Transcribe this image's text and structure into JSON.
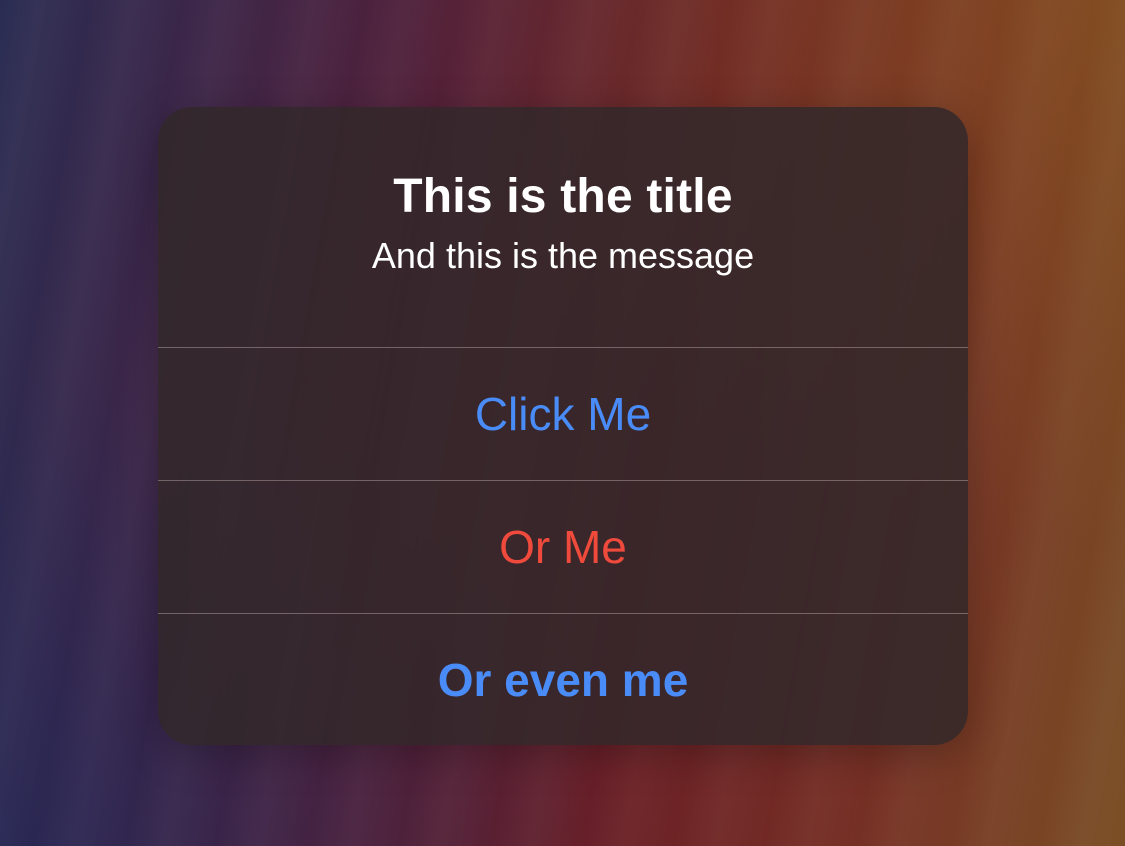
{
  "alert": {
    "title": "This is the title",
    "message": "And this is the message",
    "actions": [
      {
        "label": "Click Me",
        "style": "default",
        "color": "#4a8cf7"
      },
      {
        "label": "Or Me",
        "style": "destructive",
        "color": "#ef4a3c"
      },
      {
        "label": "Or even me",
        "style": "preferred",
        "color": "#4a8cf7"
      }
    ]
  }
}
